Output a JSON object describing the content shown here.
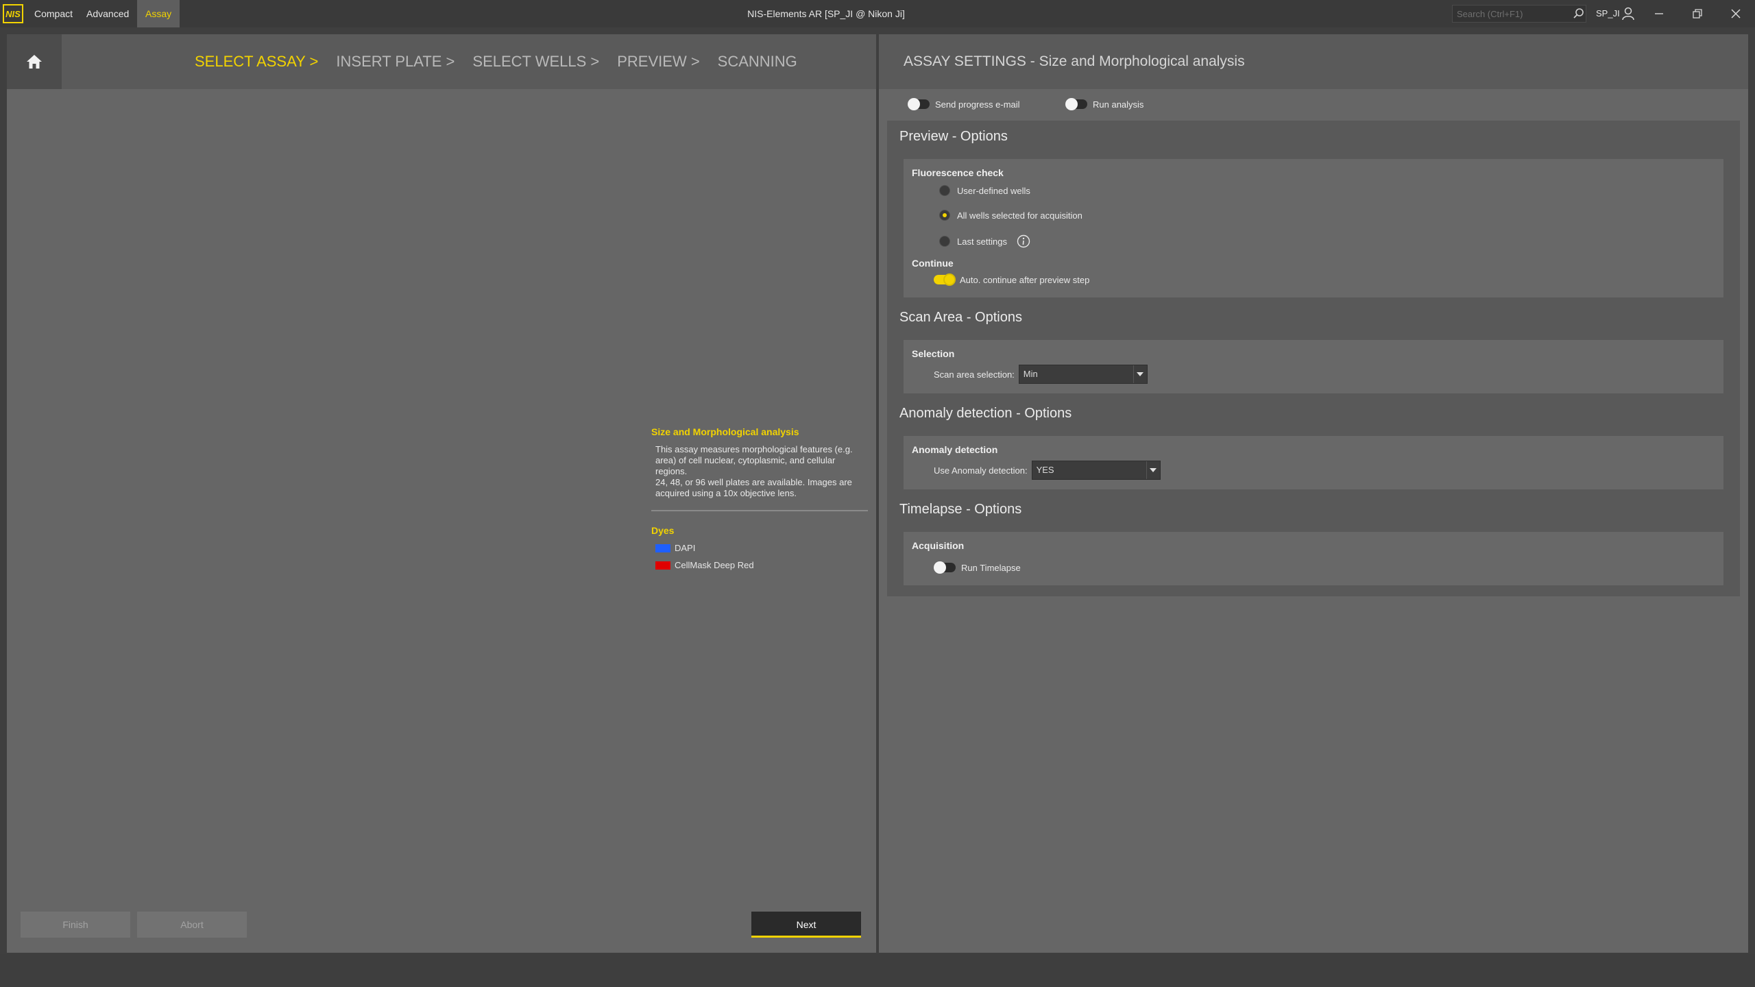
{
  "titlebar": {
    "logo": "NIS",
    "menu": [
      "Compact",
      "Advanced",
      "Assay"
    ],
    "active_menu": "Assay",
    "app_title": "NIS-Elements AR [SP_JI @ Nikon Ji]",
    "search_placeholder": "Search (Ctrl+F1)",
    "user": "SP_JI"
  },
  "wizard": {
    "steps": [
      "SELECT ASSAY >",
      "INSERT PLATE >",
      "SELECT WELLS >",
      "PREVIEW >",
      "SCANNING"
    ],
    "current": 0
  },
  "assay": {
    "name": "Size and Morphological analysis",
    "description": "This assay measures morphological features (e.g.\narea) of cell nuclear, cytoplasmic, and cellular\nregions.\n24, 48, or 96 well plates are available. Images are\nacquired using a 10x objective lens.",
    "dyes_title": "Dyes",
    "dyes": [
      {
        "name": "DAPI",
        "color": "#1f5fff"
      },
      {
        "name": "CellMask Deep Red",
        "color": "#e00000"
      }
    ]
  },
  "buttons": {
    "finish": "Finish",
    "abort": "Abort",
    "next": "Next"
  },
  "settings": {
    "title": "ASSAY SETTINGS - Size and Morphological analysis",
    "send_email": {
      "label": "Send progress e-mail",
      "on": false
    },
    "run_analysis": {
      "label": "Run analysis",
      "on": false
    },
    "preview": {
      "title": "Preview - Options",
      "fluorescence_title": "Fluorescence check",
      "options": [
        {
          "label": "User-defined wells",
          "checked": false
        },
        {
          "label": "All wells selected for acquisition",
          "checked": true
        },
        {
          "label": "Last settings",
          "checked": false
        }
      ],
      "continue_title": "Continue",
      "auto_continue": {
        "label": "Auto. continue after preview step",
        "on": true
      }
    },
    "scan_area": {
      "title": "Scan Area - Options",
      "selection_title": "Selection",
      "field_label": "Scan area selection:",
      "value": "Min"
    },
    "anomaly": {
      "title": "Anomaly detection - Options",
      "sub_title": "Anomaly detection",
      "field_label": "Use Anomaly detection:",
      "value": "YES"
    },
    "timelapse": {
      "title": "Timelapse - Options",
      "sub_title": "Acquisition",
      "run": {
        "label": "Run Timelapse",
        "on": false
      }
    }
  }
}
